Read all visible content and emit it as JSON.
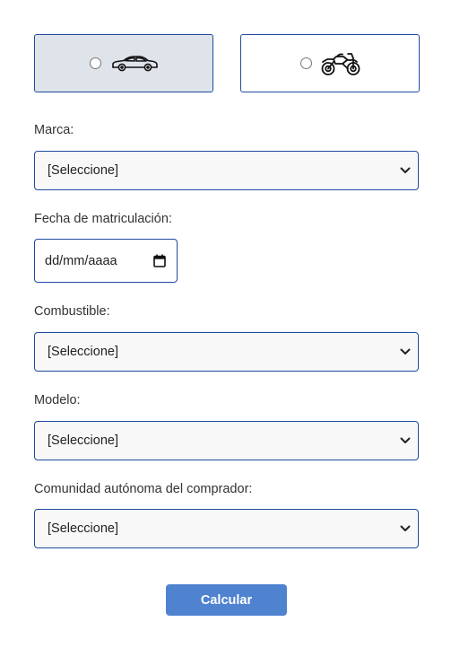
{
  "vehicle_type": {
    "options": [
      {
        "icon": "car-icon",
        "selected": true
      },
      {
        "icon": "motorcycle-icon",
        "selected": false
      }
    ]
  },
  "form": {
    "marca": {
      "label": "Marca:",
      "value": "[Seleccione]"
    },
    "fecha": {
      "label": "Fecha de matriculación:",
      "placeholder": "dd/mm/aaaa"
    },
    "combustible": {
      "label": "Combustible:",
      "value": "[Seleccione]"
    },
    "modelo": {
      "label": "Modelo:",
      "value": "[Seleccione]"
    },
    "comunidad": {
      "label": "Comunidad autónoma del comprador:",
      "value": "[Seleccione]"
    }
  },
  "actions": {
    "calculate_label": "Calcular"
  },
  "colors": {
    "border": "#1f4aa0",
    "selected_bg": "#dfe3ea",
    "button_bg": "#4f82cf",
    "select_bg": "#f8f8f8"
  }
}
